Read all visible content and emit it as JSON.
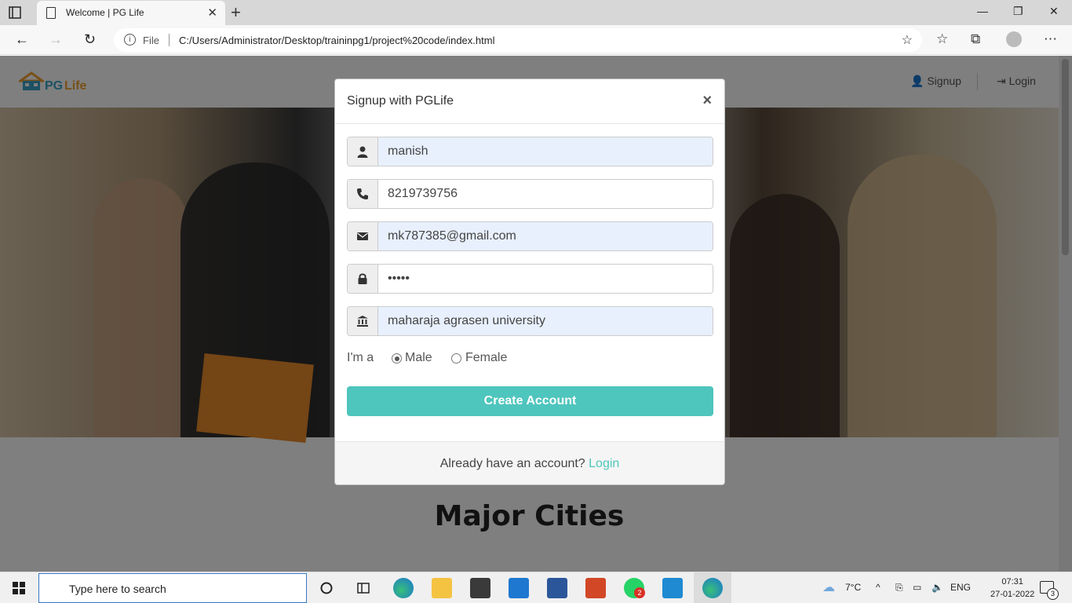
{
  "browser": {
    "tab_title": "Welcome | PG Life",
    "address_scheme": "File",
    "address_url": "C:/Users/Administrator/Desktop/traininpg1/project%20code/index.html"
  },
  "site": {
    "logo_pg": "PG",
    "logo_life": "Life",
    "nav": {
      "signup": "Signup",
      "login": "Login"
    },
    "section_title": "Major Cities"
  },
  "modal": {
    "title": "Signup with PGLife",
    "close": "×",
    "fields": {
      "name": "manish",
      "phone": "8219739756",
      "email": "mk787385@gmail.com",
      "password": "•••••",
      "college": "maharaja agrasen university"
    },
    "gender_label": "I'm a",
    "gender_options": [
      "Male",
      "Female"
    ],
    "gender_selected": "Male",
    "submit_label": "Create Account",
    "footer_text": "Already have an account?",
    "footer_link": "Login"
  },
  "taskbar": {
    "search_placeholder": "Type here to search",
    "weather": "7°C",
    "language": "ENG",
    "time": "07:31",
    "date": "27-01-2022",
    "whatsapp_badge": "2",
    "notification_count": "3"
  },
  "colors": {
    "accent": "#4ec5bd",
    "autofill_bg": "#e8f0fe",
    "logo_blue": "#3aa3c9",
    "logo_orange": "#f0a030"
  }
}
